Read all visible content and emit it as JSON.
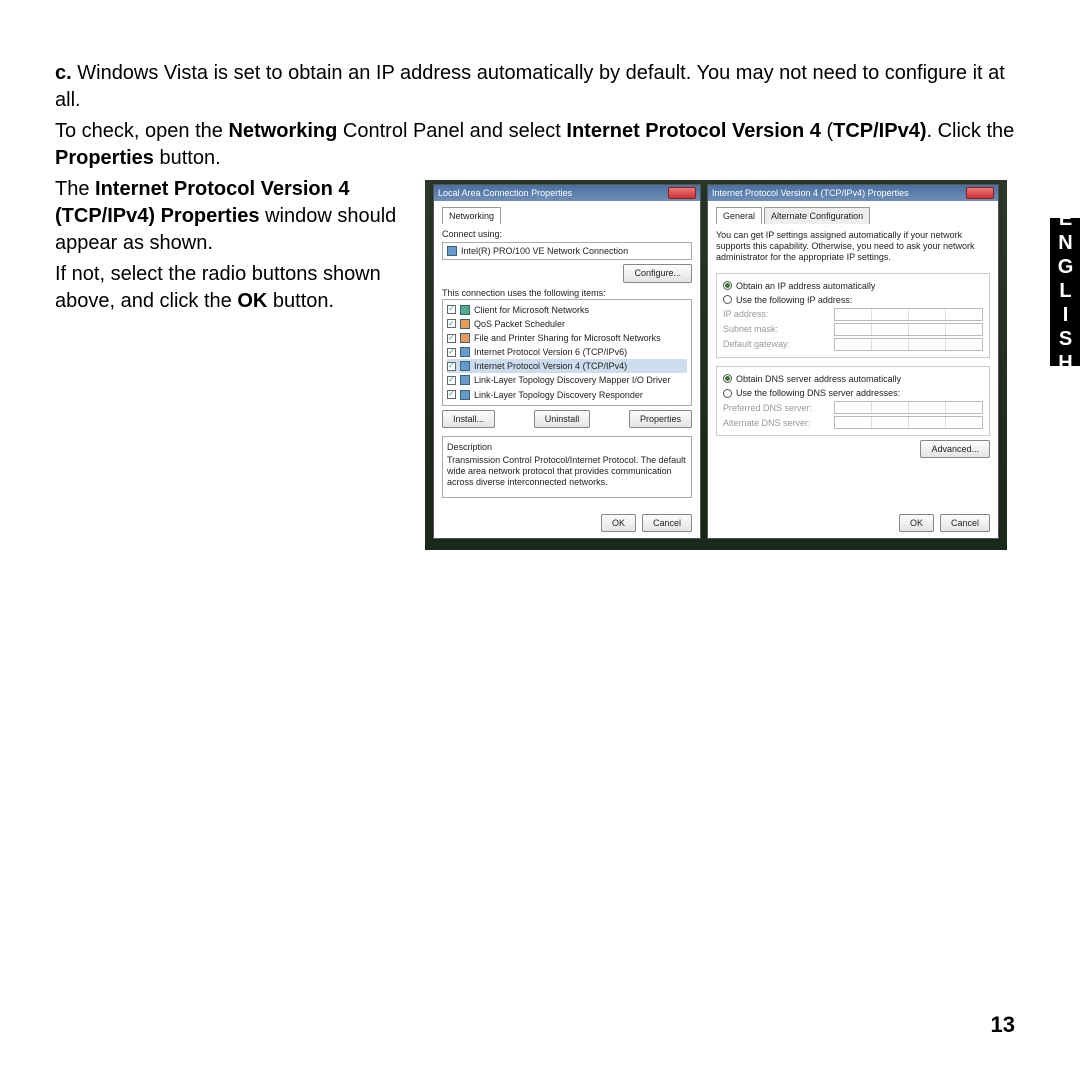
{
  "sideTab": "ENGLISH",
  "pageNumber": "13",
  "p1": {
    "lead": "c.",
    "rest": " Windows Vista is set to obtain an IP address automatically by default. You may not need to configure it at all."
  },
  "p2": {
    "a": "To check, open the ",
    "b": "Networking",
    "c": " Control Panel and select ",
    "d": "Internet Protocol Version 4",
    "e": " (",
    "f": "TCP/IPv4)",
    "g": ". Click the ",
    "h": "Properties",
    "i": " button."
  },
  "p3": {
    "a": "The ",
    "b": "Internet Protocol Version 4 (TCP/IPv4) Properties",
    "c": " window should appear as shown."
  },
  "p4": {
    "a": "If not, select the radio buttons shown above, and click the ",
    "b": "OK",
    "c": " button."
  },
  "winA": {
    "title": "Local Area Connection Properties",
    "tab": "Networking",
    "connectUsing": "Connect using:",
    "adapter": "Intel(R) PRO/100 VE Network Connection",
    "configureBtn": "Configure...",
    "itemsLabel": "This connection uses the following items:",
    "items": [
      "Client for Microsoft Networks",
      "QoS Packet Scheduler",
      "File and Printer Sharing for Microsoft Networks",
      "Internet Protocol Version 6 (TCP/IPv6)",
      "Internet Protocol Version 4 (TCP/IPv4)",
      "Link-Layer Topology Discovery Mapper I/O Driver",
      "Link-Layer Topology Discovery Responder"
    ],
    "installBtn": "Install...",
    "uninstallBtn": "Uninstall",
    "propertiesBtn": "Properties",
    "descLabel": "Description",
    "descText": "Transmission Control Protocol/Internet Protocol. The default wide area network protocol that provides communication across diverse interconnected networks.",
    "ok": "OK",
    "cancel": "Cancel"
  },
  "winB": {
    "title": "Internet Protocol Version 4 (TCP/IPv4) Properties",
    "tabGeneral": "General",
    "tabAlt": "Alternate Configuration",
    "help": "You can get IP settings assigned automatically if your network supports this capability. Otherwise, you need to ask your network administrator for the appropriate IP settings.",
    "rAuto": "Obtain an IP address automatically",
    "rManual": "Use the following IP address:",
    "ip": "IP address:",
    "mask": "Subnet mask:",
    "gw": "Default gateway:",
    "dnsAuto": "Obtain DNS server address automatically",
    "dnsManual": "Use the following DNS server addresses:",
    "pdns": "Preferred DNS server:",
    "adns": "Alternate DNS server:",
    "advanced": "Advanced...",
    "ok": "OK",
    "cancel": "Cancel"
  }
}
